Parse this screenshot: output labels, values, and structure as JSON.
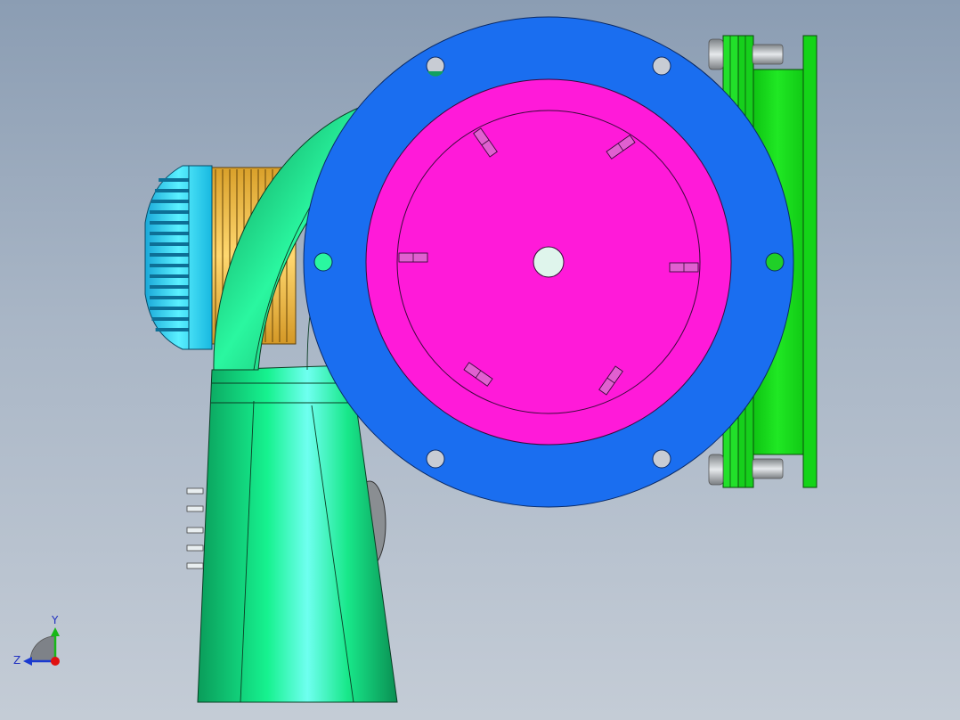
{
  "viewport": {
    "model": "blower-assembly",
    "background_top": "#8b9db3",
    "background_bottom": "#c4ccd6"
  },
  "colors": {
    "flange": "#1a6ef0",
    "impeller_face": "#ff1ad9",
    "duct": "#12f58c",
    "motor_fins": "#33e0f5",
    "motor_body": "#f5c242",
    "mount_plate": "#14e11a",
    "bolt": "#b0b4b8"
  },
  "triad": {
    "y_label": "Y",
    "z_label": "Z",
    "y_color": "#18b818",
    "z_color": "#1a3ad0",
    "x_color": "#e01010"
  }
}
